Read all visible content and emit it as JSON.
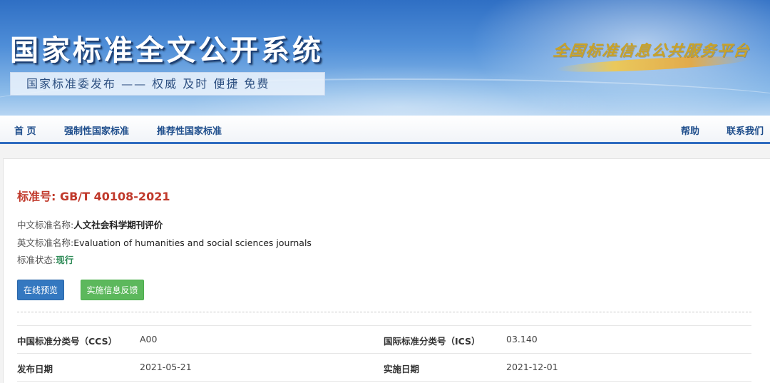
{
  "banner": {
    "title": "国家标准全文公开系统",
    "subtitle": "国家标准委发布 —— 权威 及时 便捷 免费",
    "platform": "全国标准信息公共服务平台"
  },
  "nav": {
    "home": "首 页",
    "mandatory": "强制性国家标准",
    "recommended": "推荐性国家标准",
    "help": "帮助",
    "contact": "联系我们"
  },
  "standard": {
    "number_label": "标准号: GB/T 40108-2021",
    "cn_name_label": "中文标准名称:",
    "cn_name": "人文社会科学期刊评价",
    "en_name_label": "英文标准名称:",
    "en_name": "Evaluation of humanities and social sciences journals",
    "status_label": "标准状态:",
    "status": "现行"
  },
  "buttons": {
    "preview": "在线预览",
    "feedback": "实施信息反馈"
  },
  "info": {
    "ccs_label": "中国标准分类号（CCS）",
    "ccs_value": "A00",
    "ics_label": "国际标准分类号（ICS）",
    "ics_value": "03.140",
    "publish_label": "发布日期",
    "publish_value": "2021-05-21",
    "implement_label": "实施日期",
    "implement_value": "2021-12-01"
  },
  "colors": {
    "nav_accent": "#2e6bbf",
    "standard_number": "#c0392b",
    "status": "#2e8b57",
    "preview_button": "#3478c0",
    "feedback_button": "#5cb85c"
  }
}
